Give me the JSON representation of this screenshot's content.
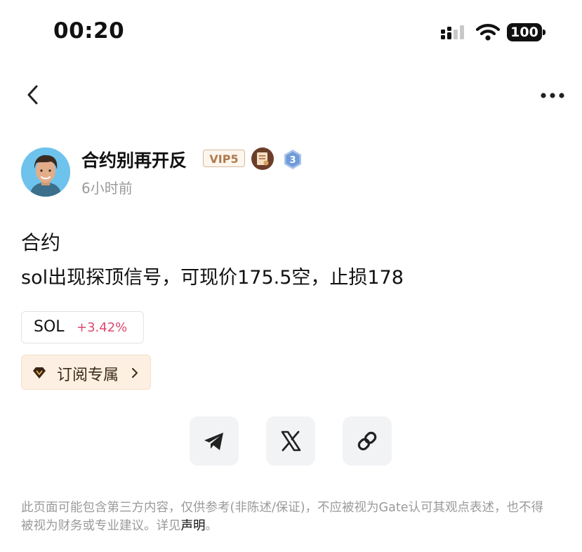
{
  "status_bar": {
    "time": "00:20",
    "battery": "100"
  },
  "author": {
    "name": "合约别再开反",
    "vip": "VIP5",
    "level": "3",
    "time_ago": "6小时前"
  },
  "post": {
    "line1": "合约",
    "line2": "sol出现探顶信号，可现价175.5空，止损178"
  },
  "ticker": {
    "symbol": "SOL",
    "change": "+3.42%",
    "change_color": "#e0476f"
  },
  "subscribe": {
    "label": "订阅专属"
  },
  "share": {
    "icons": [
      "telegram-icon",
      "x-icon",
      "link-icon"
    ]
  },
  "disclaimer": {
    "text": "此页面可能包含第三方内容，仅供参考(非陈述/保证)，不应被视为Gate认可其观点表述，也不得被视为财务或专业建议。详见",
    "link": "声明",
    "end": "。"
  }
}
